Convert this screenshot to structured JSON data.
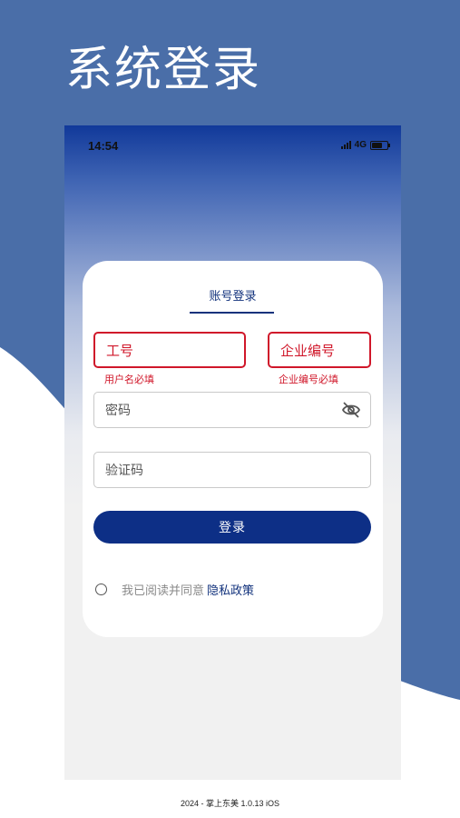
{
  "headline": "系统登录",
  "status_bar": {
    "time": "14:54",
    "network": "4G"
  },
  "login": {
    "tab_label": "账号登录",
    "employee_id": {
      "placeholder": "工号",
      "error": "用户名必填"
    },
    "company_code": {
      "placeholder": "企业编号",
      "error": "企业编号必填"
    },
    "password": {
      "placeholder": "密码"
    },
    "captcha": {
      "placeholder": "验证码"
    },
    "login_button": "登录",
    "agreement_text": "我已阅读并同意",
    "privacy_link": "隐私政策"
  },
  "footer": "2024 - 掌上东美 1.0.13 iOS",
  "colors": {
    "brand_blue": "#4a6ea8",
    "primary": "#0d2f86",
    "error": "#d0172a"
  }
}
